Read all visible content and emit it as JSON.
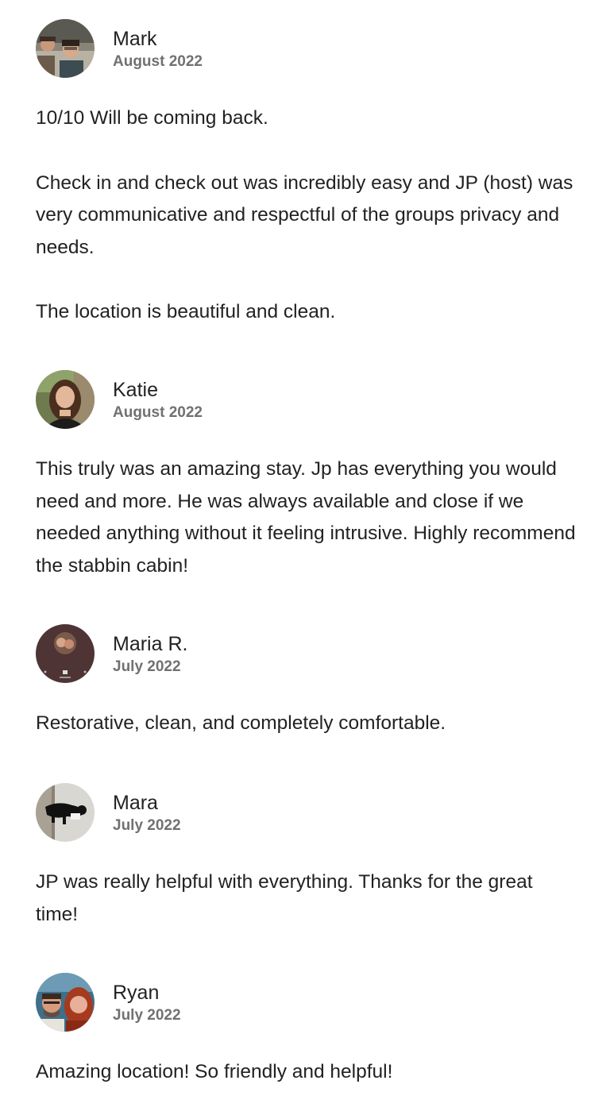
{
  "reviews": [
    {
      "name": "Mark",
      "date": "August 2022",
      "avatar_icon": "photo-avatar-two-men-in-car",
      "paragraphs": [
        "10/10 Will be coming back.",
        "Check in and check out was incredibly easy and JP (host) was very communicative and respectful of the groups privacy and needs.",
        "The location is beautiful and clean."
      ]
    },
    {
      "name": "Katie",
      "date": "August 2022",
      "avatar_icon": "photo-avatar-woman-portrait",
      "paragraphs": [
        "This truly was an amazing stay. Jp has everything you would need and more. He was always available and close if we needed anything without it feeling intrusive. Highly recommend the stabbin cabin!"
      ]
    },
    {
      "name": "Maria R.",
      "date": "July 2022",
      "avatar_icon": "photo-avatar-video-call",
      "paragraphs": [
        "Restorative, clean, and completely comfortable."
      ]
    },
    {
      "name": "Mara",
      "date": "July 2022",
      "avatar_icon": "photo-avatar-black-dog",
      "paragraphs": [
        "JP was really helpful with everything. Thanks for the great time!"
      ]
    },
    {
      "name": "Ryan",
      "date": "July 2022",
      "avatar_icon": "photo-avatar-couple-selfie",
      "paragraphs": [
        "Amazing location! So friendly and helpful!"
      ]
    }
  ],
  "colors": {
    "text_primary": "#222222",
    "text_secondary": "#717171",
    "background": "#ffffff"
  }
}
